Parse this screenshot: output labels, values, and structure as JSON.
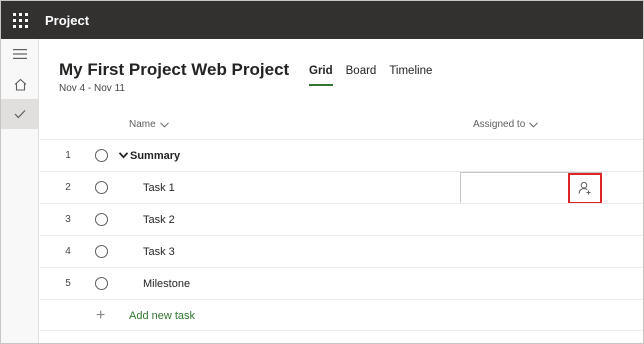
{
  "app": {
    "title": "Project"
  },
  "rail": {
    "items": [
      {
        "icon": "hamburger-icon"
      },
      {
        "icon": "home-icon"
      },
      {
        "icon": "checkmark-icon",
        "active": true
      }
    ]
  },
  "project": {
    "title": "My First Project Web Project",
    "dates": "Nov 4 - Nov 11"
  },
  "tabs": [
    {
      "label": "Grid",
      "active": true
    },
    {
      "label": "Board",
      "active": false
    },
    {
      "label": "Timeline",
      "active": false
    }
  ],
  "columns": {
    "name": "Name",
    "assigned": "Assigned to"
  },
  "rows": [
    {
      "num": "1",
      "name": "Summary",
      "summary": true
    },
    {
      "num": "2",
      "name": "Task 1",
      "summary": false
    },
    {
      "num": "3",
      "name": "Task 2",
      "summary": false
    },
    {
      "num": "4",
      "name": "Task 3",
      "summary": false
    },
    {
      "num": "5",
      "name": "Milestone",
      "summary": false
    }
  ],
  "add_task_label": "Add new task",
  "colors": {
    "topbar": "#323130",
    "accent": "#31752f",
    "highlight": "#e02323"
  }
}
